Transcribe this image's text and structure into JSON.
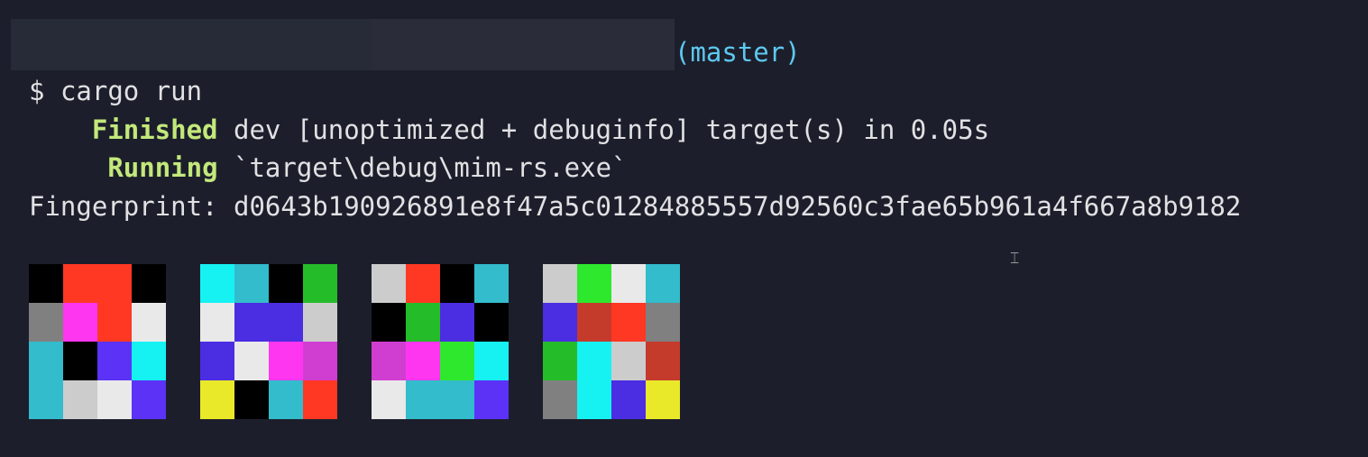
{
  "terminal": {
    "prompt": {
      "branch": "(master)"
    },
    "command": {
      "symbol": "$",
      "text": "cargo run"
    },
    "finished": {
      "status": "Finished",
      "message": "dev [unoptimized + debuginfo] target(s) in 0.05s"
    },
    "running": {
      "status": "Running",
      "message": "`target\\debug\\mim-rs.exe`"
    },
    "fingerprint": {
      "label": "Fingerprint:",
      "value": "d0643b190926891e8f47a5c01284885557d92560c3fae65b961a4f667a8b9182"
    }
  },
  "colors": {
    "background": "#1c1f2b",
    "text": "#e1e1e4",
    "branch": "#5ec8f0",
    "cargo_status": "#c3e87b"
  },
  "identicons": [
    [
      "#000000",
      "#ff3824",
      "#ff3824",
      "#000000",
      "#808080",
      "#ff36f0",
      "#ff3824",
      "#e9e9e9",
      "#33bccb",
      "#000000",
      "#5b32f6",
      "#16f2f2",
      "#33bccb",
      "#cccccc",
      "#e9e9e9",
      "#5b32f6"
    ],
    [
      "#16f2f2",
      "#33bccb",
      "#000000",
      "#25bc2a",
      "#e9e9e9",
      "#4b2de2",
      "#4b2de2",
      "#cccccc",
      "#4b2de2",
      "#e9e9e9",
      "#ff36f0",
      "#d03ed1",
      "#e9e92a",
      "#000000",
      "#33bccb",
      "#ff3824"
    ],
    [
      "#cccccc",
      "#ff3824",
      "#000000",
      "#33bccb",
      "#000000",
      "#25bc2a",
      "#4b2de2",
      "#000000",
      "#d03ed1",
      "#ff36f0",
      "#2ee82e",
      "#16f2f2",
      "#e9e9e9",
      "#33bccb",
      "#33bccb",
      "#5b32f6"
    ],
    [
      "#cccccc",
      "#2ee82e",
      "#e9e9e9",
      "#33bccb",
      "#4b2de2",
      "#c43b2c",
      "#ff3824",
      "#808080",
      "#25bc2a",
      "#16f2f2",
      "#cccccc",
      "#c43b2c",
      "#808080",
      "#16f2f2",
      "#4b2de2",
      "#e9e92a"
    ]
  ]
}
